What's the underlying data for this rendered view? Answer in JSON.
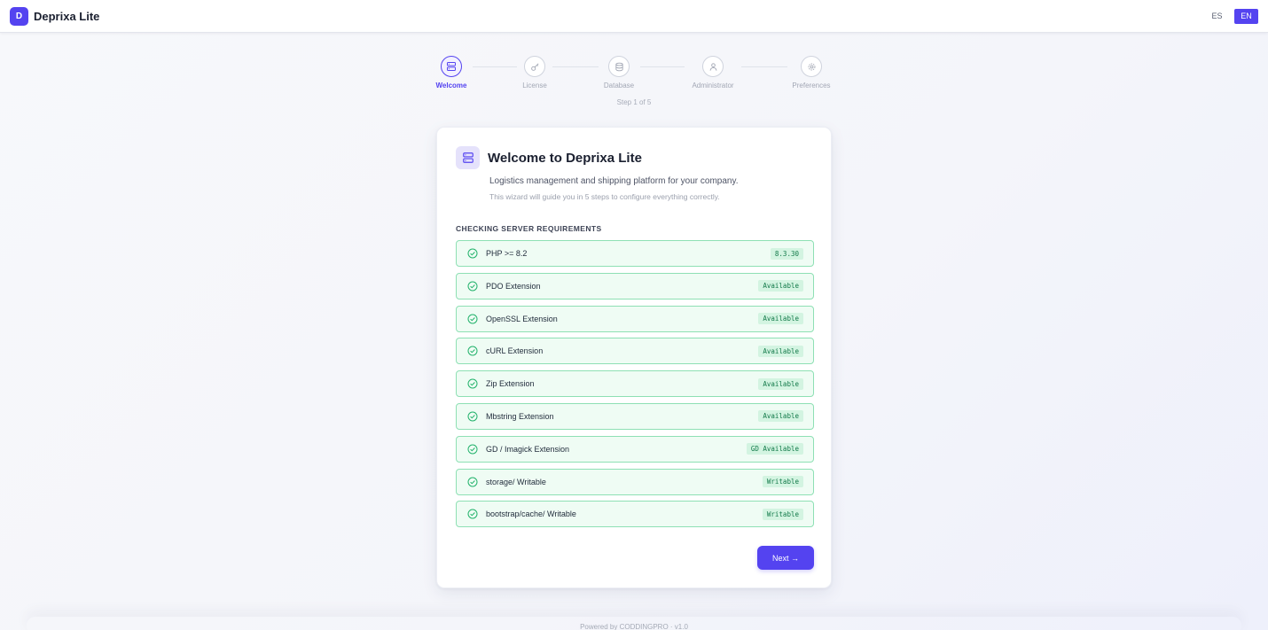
{
  "header": {
    "logo_letter": "D",
    "brand": "Deprixa Lite",
    "languages": [
      {
        "code": "ES",
        "active": false
      },
      {
        "code": "EN",
        "active": true
      }
    ]
  },
  "stepper": {
    "steps": [
      {
        "label": "Welcome",
        "icon": "server-icon",
        "active": true
      },
      {
        "label": "License",
        "icon": "key-icon",
        "active": false
      },
      {
        "label": "Database",
        "icon": "database-icon",
        "active": false
      },
      {
        "label": "Administrator",
        "icon": "user-icon",
        "active": false
      },
      {
        "label": "Preferences",
        "icon": "gear-icon",
        "active": false
      }
    ],
    "counter": "Step 1 of 5"
  },
  "card": {
    "icon": "server-icon",
    "title": "Welcome to Deprixa Lite",
    "subtitle": "Logistics management and shipping platform for your company.",
    "hint": "This wizard will guide you in 5 steps to configure everything correctly.",
    "section_title": "CHECKING SERVER REQUIREMENTS",
    "requirements": [
      {
        "label": "PHP >= 8.2",
        "status": "8.3.30"
      },
      {
        "label": "PDO Extension",
        "status": "Available"
      },
      {
        "label": "OpenSSL Extension",
        "status": "Available"
      },
      {
        "label": "cURL Extension",
        "status": "Available"
      },
      {
        "label": "Zip Extension",
        "status": "Available"
      },
      {
        "label": "Mbstring Extension",
        "status": "Available"
      },
      {
        "label": "GD / Imagick Extension",
        "status": "GD Available"
      },
      {
        "label": "storage/ Writable",
        "status": "Writable"
      },
      {
        "label": "bootstrap/cache/ Writable",
        "status": "Writable"
      }
    ],
    "next_label": "Next →"
  },
  "footer": {
    "text": "Powered by CODDINGPRO · v1.0"
  },
  "colors": {
    "accent": "#5443f0",
    "success_border": "#8ee0b4",
    "success_bg": "#effcf4",
    "success_text": "#137a4a"
  }
}
